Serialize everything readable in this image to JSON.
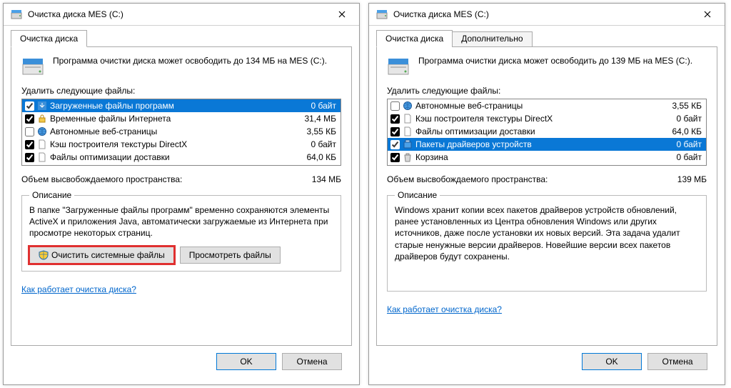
{
  "left": {
    "title": "Очистка диска MES (C:)",
    "tabs": [
      "Очистка диска"
    ],
    "header": "Программа очистки диска может освободить до 134 МБ на MES (C:).",
    "delete_label": "Удалить следующие файлы:",
    "items": [
      {
        "checked": true,
        "icon": "download-icon",
        "name": "Загруженные файлы программ",
        "size": "0 байт",
        "selected": true
      },
      {
        "checked": true,
        "icon": "lock-icon",
        "name": "Временные файлы Интернета",
        "size": "31,4 МБ"
      },
      {
        "checked": false,
        "icon": "globe-icon",
        "name": "Автономные веб-страницы",
        "size": "3,55 КБ"
      },
      {
        "checked": true,
        "icon": "file-icon",
        "name": "Кэш построителя текстуры DirectX",
        "size": "0 байт"
      },
      {
        "checked": true,
        "icon": "file-icon",
        "name": "Файлы оптимизации доставки",
        "size": "64,0 КБ"
      }
    ],
    "free_label": "Объем высвобождаемого пространства:",
    "free_value": "134 МБ",
    "desc_legend": "Описание",
    "desc_text": "В папке \"Загруженные файлы программ\" временно сохраняются элементы ActiveX и приложения Java, автоматически загружаемые из Интернета при просмотре некоторых страниц.",
    "btn_clean_sys": "Очистить системные файлы",
    "btn_view": "Просмотреть файлы",
    "link": "Как работает очистка диска?",
    "ok": "OK",
    "cancel": "Отмена"
  },
  "right": {
    "title": "Очистка диска MES (C:)",
    "tabs": [
      "Очистка диска",
      "Дополнительно"
    ],
    "header": "Программа очистки диска может освободить до 139 МБ на MES (C:).",
    "delete_label": "Удалить следующие файлы:",
    "items": [
      {
        "checked": false,
        "icon": "globe-icon",
        "name": "Автономные веб-страницы",
        "size": "3,55 КБ"
      },
      {
        "checked": true,
        "icon": "file-icon",
        "name": "Кэш построителя текстуры DirectX",
        "size": "0 байт"
      },
      {
        "checked": true,
        "icon": "file-icon",
        "name": "Файлы оптимизации доставки",
        "size": "64,0 КБ"
      },
      {
        "checked": true,
        "icon": "driver-icon",
        "name": "Пакеты драйверов устройств",
        "size": "0 байт",
        "selected": true
      },
      {
        "checked": true,
        "icon": "trash-icon",
        "name": "Корзина",
        "size": "0 байт"
      }
    ],
    "free_label": "Объем высвобождаемого пространства:",
    "free_value": "139 МБ",
    "desc_legend": "Описание",
    "desc_text": "Windows хранит копии всех пакетов драйверов устройств обновлений, ранее установленных из Центра обновления Windows или других источников, даже после установки их новых версий. Эта задача удалит старые ненужные версии драйверов. Новейшие версии всех пакетов драйверов будут сохранены.",
    "link": "Как работает очистка диска?",
    "ok": "OK",
    "cancel": "Отмена"
  }
}
